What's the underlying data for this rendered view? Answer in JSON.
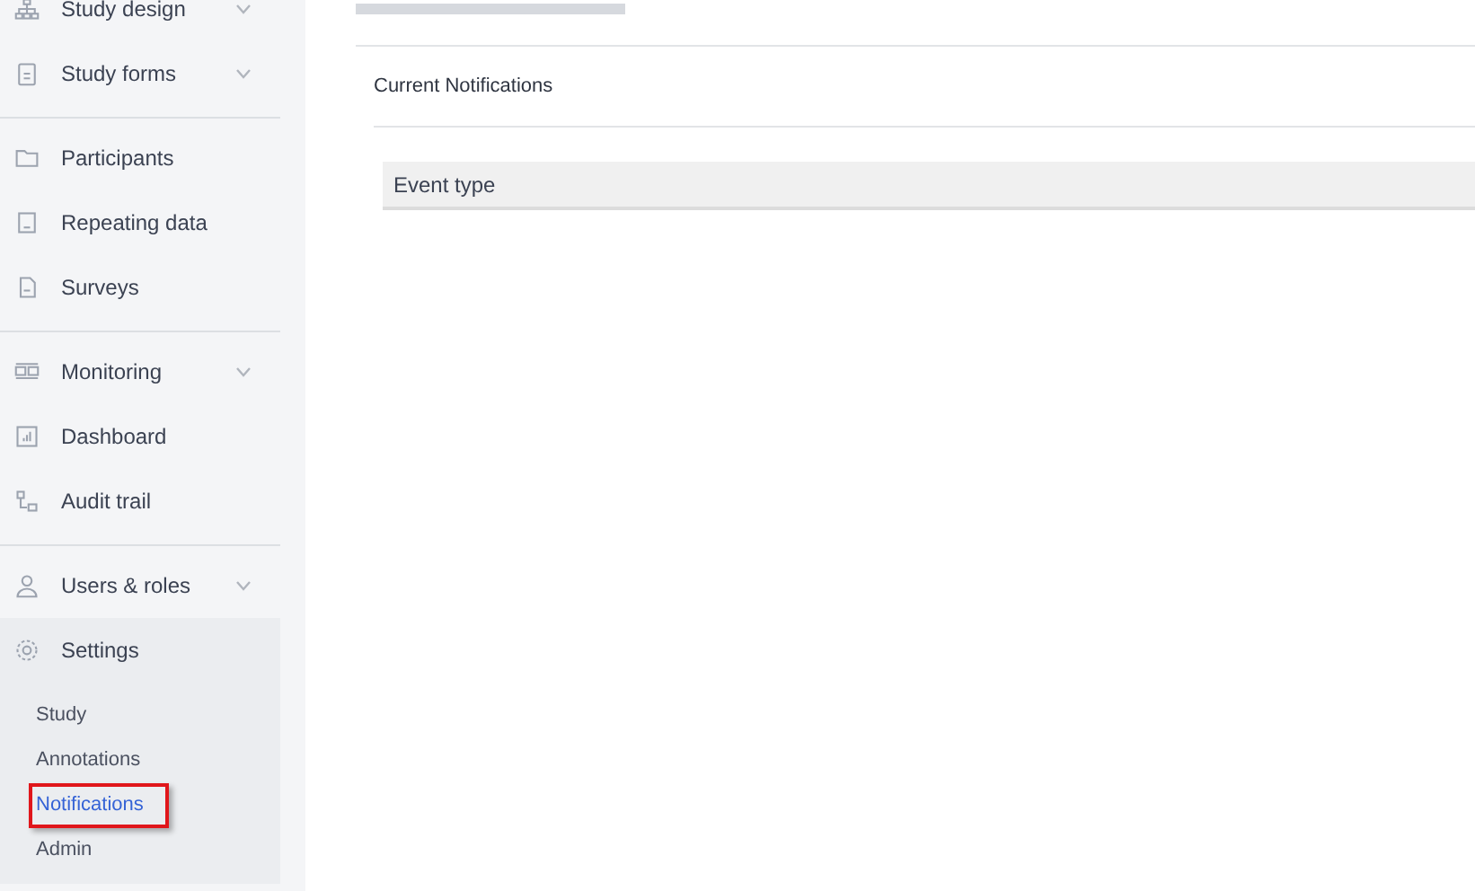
{
  "sidebar": {
    "groups": [
      {
        "items": [
          {
            "label": "Study design",
            "expanded": false
          },
          {
            "label": "Study forms",
            "expanded": false
          }
        ]
      },
      {
        "items": [
          {
            "label": "Participants"
          },
          {
            "label": "Repeating data"
          },
          {
            "label": "Surveys"
          }
        ]
      },
      {
        "items": [
          {
            "label": "Monitoring",
            "expanded": false
          },
          {
            "label": "Dashboard"
          },
          {
            "label": "Audit trail"
          }
        ]
      },
      {
        "items": [
          {
            "label": "Users & roles",
            "expanded": false
          },
          {
            "label": "Settings",
            "expanded": true,
            "children": [
              {
                "label": "Study",
                "selected": false,
                "highlighted": false
              },
              {
                "label": "Annotations",
                "selected": false,
                "highlighted": false
              },
              {
                "label": "Notifications",
                "selected": true,
                "highlighted": true
              },
              {
                "label": "Admin",
                "selected": false,
                "highlighted": false
              }
            ]
          }
        ]
      }
    ]
  },
  "main": {
    "section_title": "Current Notifications",
    "table": {
      "columns": [
        "Event type"
      ]
    }
  }
}
